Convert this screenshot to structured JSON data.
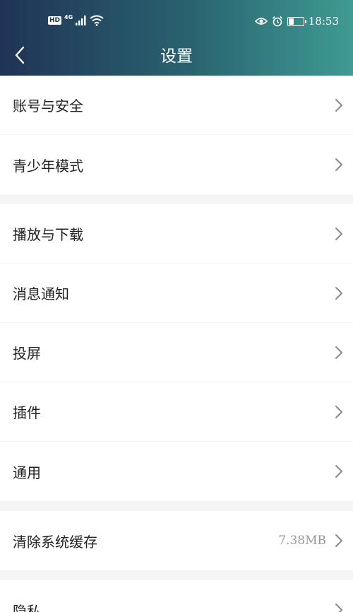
{
  "status_bar": {
    "hd": "HD",
    "network": "4G",
    "time": "18:53",
    "battery_level": 0.35
  },
  "header": {
    "title": "设置"
  },
  "groups": [
    {
      "items": [
        {
          "label": "账号与安全"
        },
        {
          "label": "青少年模式"
        }
      ]
    },
    {
      "items": [
        {
          "label": "播放与下载"
        },
        {
          "label": "消息通知"
        },
        {
          "label": "投屏"
        },
        {
          "label": "插件"
        },
        {
          "label": "通用"
        }
      ]
    },
    {
      "items": [
        {
          "label": "清除系统缓存",
          "value": "7.38MB"
        }
      ]
    },
    {
      "items": [
        {
          "label": "隐私"
        }
      ]
    }
  ],
  "colors": {
    "header_start": "#1f3356",
    "header_end": "#3f9b93",
    "page_bg": "#f5f5f5"
  }
}
